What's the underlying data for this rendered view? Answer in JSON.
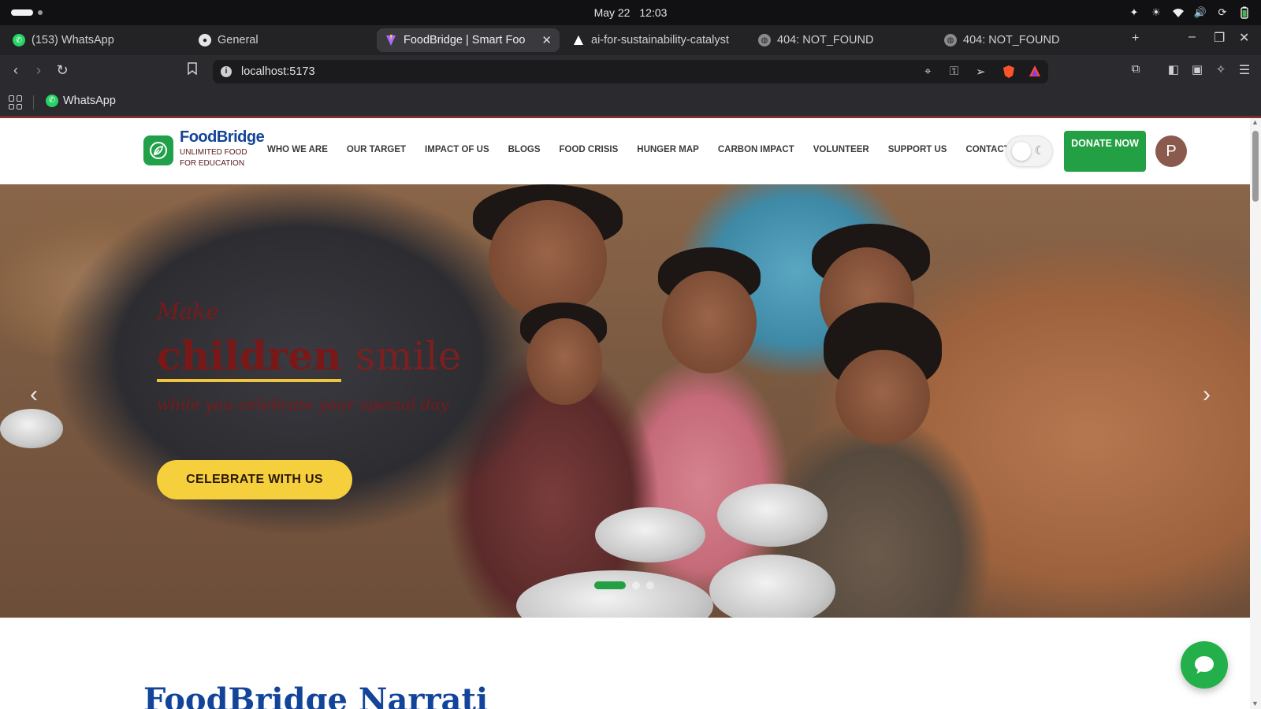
{
  "os": {
    "date": "May 22",
    "time": "12:03",
    "tray_icons": [
      "accessibility-icon",
      "brightness-icon",
      "wifi-icon",
      "volume-icon",
      "sync-icon",
      "battery-icon"
    ]
  },
  "browser": {
    "tabs": [
      {
        "label": "(153) WhatsApp",
        "icon": "whatsapp-icon",
        "color": "#25d366"
      },
      {
        "label": "General",
        "icon": "github-icon",
        "color": "#e6e6e6"
      },
      {
        "label": "FoodBridge | Smart Foo",
        "icon": "vite-icon",
        "color": "#a86bff",
        "active": true
      },
      {
        "label": "ai-for-sustainability-catalyst",
        "icon": "vercel-icon",
        "color": "#ffffff"
      },
      {
        "label": "404: NOT_FOUND",
        "icon": "globe-icon",
        "color": "#bdbdbd"
      },
      {
        "label": "404: NOT_FOUND",
        "icon": "globe-icon",
        "color": "#bdbdbd"
      }
    ],
    "new_tab_symbol": "+",
    "url": "localhost:5173",
    "bookmarks": [
      {
        "label": "WhatsApp",
        "icon": "whatsapp-icon"
      }
    ]
  },
  "site": {
    "brand_name": "FoodBridge",
    "brand_tagline": "UNLIMITED FOOD FOR EDUCATION",
    "nav": [
      "WHO WE ARE",
      "OUR TARGET",
      "IMPACT OF US",
      "BLOGS",
      "FOOD CRISIS",
      "HUNGER MAP",
      "CARBON IMPACT",
      "VOLUNTEER",
      "SUPPORT US",
      "CONTACT US"
    ],
    "donate_label": "DONATE NOW",
    "avatar_initial": "P",
    "colors": {
      "brand_blue": "#12449a",
      "accent_green": "#23a043",
      "cta_yellow": "#f6cf3d",
      "headline_maroon": "#6a1616"
    }
  },
  "hero": {
    "kicker": "Make",
    "headline_highlight": "children",
    "headline_rest": "smile",
    "subtitle": "while you celebrate your special day",
    "cta_label": "CELEBRATE WITH US",
    "slide_count": 3,
    "active_slide": 1
  },
  "section": {
    "heading_partial": "FoodBridge Narrati"
  }
}
